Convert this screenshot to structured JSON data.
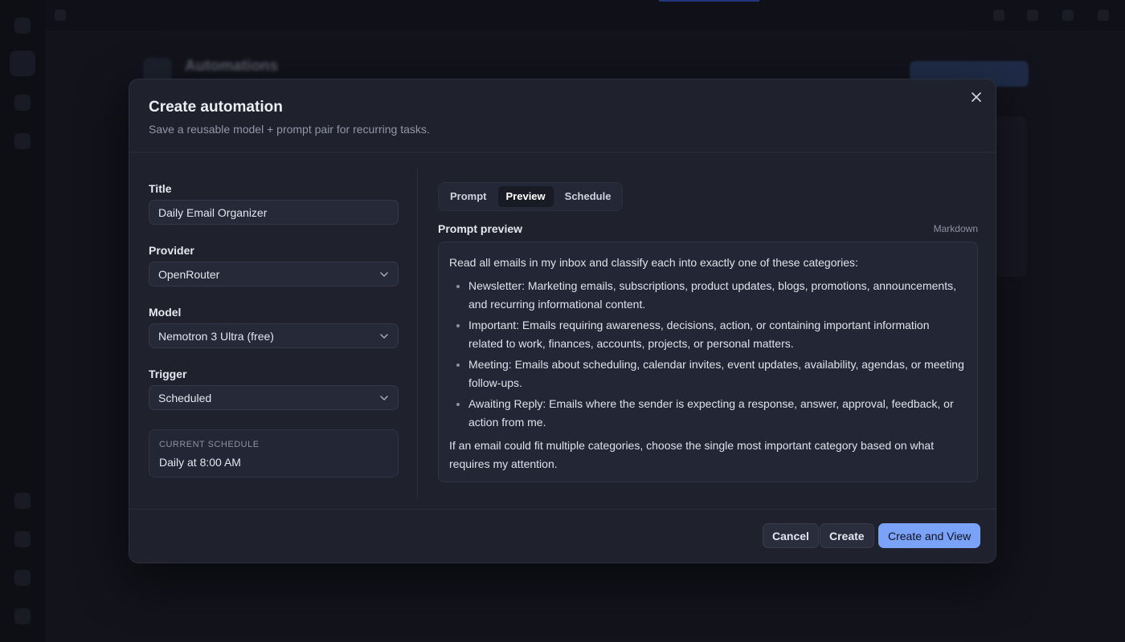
{
  "background": {
    "page_title": "Automations",
    "new_button_label": "+ New automation"
  },
  "modal": {
    "title": "Create automation",
    "subtitle": "Save a reusable model + prompt pair for recurring tasks.",
    "close_icon": "close-icon"
  },
  "form": {
    "title_label": "Title",
    "title_value": "Daily Email Organizer",
    "provider_label": "Provider",
    "provider_value": "OpenRouter",
    "model_label": "Model",
    "model_value": "Nemotron 3 Ultra (free)",
    "trigger_label": "Trigger",
    "trigger_value": "Scheduled",
    "schedule_label": "CURRENT SCHEDULE",
    "schedule_value": "Daily at 8:00 AM"
  },
  "tabs": [
    {
      "label": "Prompt",
      "active": false
    },
    {
      "label": "Preview",
      "active": true
    },
    {
      "label": "Schedule",
      "active": false
    }
  ],
  "preview": {
    "title": "Prompt preview",
    "format_tag": "Markdown",
    "intro": "Read all emails in my inbox and classify each into exactly one of these categories:",
    "items": [
      "Newsletter: Marketing emails, subscriptions, product updates, blogs, promotions, announcements, and recurring informational content.",
      "Important: Emails requiring awareness, decisions, action, or containing important information related to work, finances, accounts, projects, or personal matters.",
      "Meeting: Emails about scheduling, calendar invites, event updates, availability, agendas, or meeting follow-ups.",
      "Awaiting Reply: Emails where the sender is expecting a response, answer, approval, feedback, or action from me."
    ],
    "outro": "If an email could fit multiple categories, choose the single most important category based on what requires my attention."
  },
  "footer": {
    "cancel_label": "Cancel",
    "create_label": "Create",
    "create_view_label": "Create and View"
  },
  "colors": {
    "accent": "#7aa2f7",
    "modal_bg": "#1f212c",
    "page_bg": "#14161e"
  }
}
